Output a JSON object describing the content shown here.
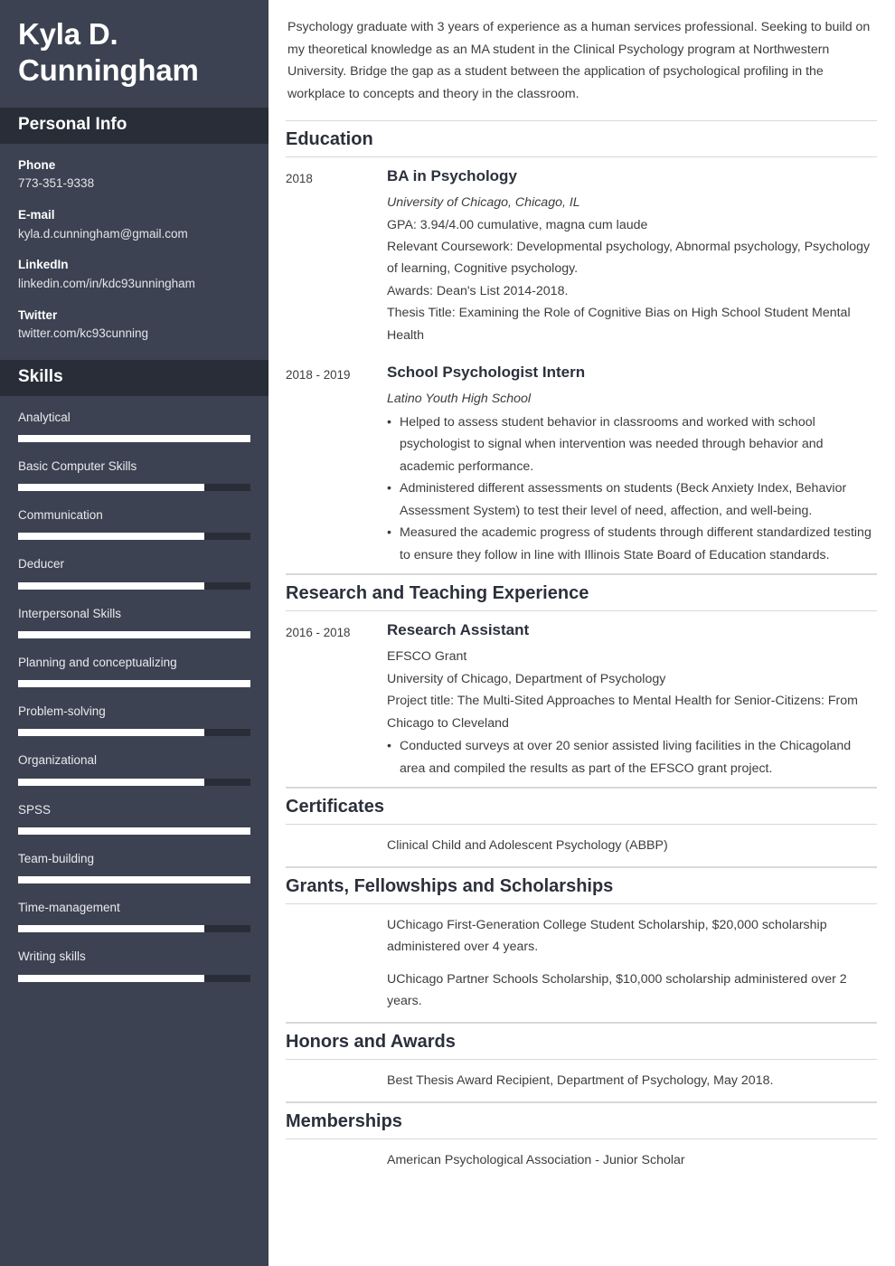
{
  "sidebar": {
    "name_lines": [
      "Kyla D.",
      "Cunningham"
    ],
    "personal_info": {
      "heading": "Personal Info",
      "items": [
        {
          "label": "Phone",
          "value": "773-351-9338"
        },
        {
          "label": "E-mail",
          "value": "kyla.d.cunningham@gmail.com"
        },
        {
          "label": "LinkedIn",
          "value": "linkedin.com/in/kdc93unningham"
        },
        {
          "label": "Twitter",
          "value": "twitter.com/kc93cunning"
        }
      ]
    },
    "skills": {
      "heading": "Skills",
      "items": [
        {
          "name": "Analytical",
          "level": 100
        },
        {
          "name": "Basic Computer Skills",
          "level": 80
        },
        {
          "name": "Communication",
          "level": 80
        },
        {
          "name": "Deducer",
          "level": 80
        },
        {
          "name": "Interpersonal Skills",
          "level": 100
        },
        {
          "name": "Planning and conceptualizing",
          "level": 100
        },
        {
          "name": "Problem-solving",
          "level": 80
        },
        {
          "name": "Organizational",
          "level": 80
        },
        {
          "name": "SPSS",
          "level": 100
        },
        {
          "name": "Team-building",
          "level": 100
        },
        {
          "name": "Time-management",
          "level": 80
        },
        {
          "name": "Writing skills",
          "level": 80
        }
      ]
    }
  },
  "main": {
    "summary": "Psychology graduate with 3 years of experience as a human services professional. Seeking to build on my theoretical knowledge as an MA student in the Clinical Psychology program at Northwestern University. Bridge the gap as a student between the application of psychological profiling in the workplace to concepts and theory in the classroom.",
    "education": {
      "heading": "Education",
      "entries": [
        {
          "date": "2018",
          "title": "BA in Psychology",
          "subtitle": "University of Chicago, Chicago, IL",
          "lines": [
            "GPA: 3.94/4.00 cumulative, magna cum laude",
            "Relevant Coursework: Developmental psychology, Abnormal psychology, Psychology of learning, Cognitive psychology.",
            "Awards: Dean's List 2014-2018.",
            "Thesis Title: Examining the Role of Cognitive Bias on High School Student Mental Health"
          ],
          "bullets": []
        },
        {
          "date": "2018 - 2019",
          "title": "School Psychologist Intern",
          "subtitle": "Latino Youth High School",
          "lines": [],
          "bullets": [
            "Helped to assess student behavior in classrooms and worked with school psychologist to signal when intervention was needed through behavior and academic performance.",
            "Administered different assessments on students (Beck Anxiety Index, Behavior Assessment System) to test their level of need, affection, and well-being.",
            "Measured the academic progress of students through different standardized testing to ensure they follow in line with Illinois State Board of Education standards."
          ]
        }
      ]
    },
    "research": {
      "heading": "Research and Teaching Experience",
      "entries": [
        {
          "date": "2016 - 2018",
          "title": "Research Assistant",
          "subtitle": "",
          "lines": [
            "EFSCO Grant",
            "University of Chicago, Department of Psychology",
            "Project title: The Multi-Sited Approaches to Mental Health for Senior-Citizens: From Chicago to Cleveland"
          ],
          "bullets": [
            "Conducted surveys at over 20 senior assisted living facilities in the Chicagoland area and compiled the results as part of the EFSCO grant project."
          ]
        }
      ]
    },
    "certificates": {
      "heading": "Certificates",
      "paragraphs": [
        "Clinical Child and Adolescent Psychology (ABBP)"
      ]
    },
    "grants": {
      "heading": "Grants, Fellowships and Scholarships",
      "paragraphs": [
        "UChicago First-Generation College Student Scholarship, $20,000 scholarship administered over 4 years.",
        "UChicago Partner Schools Scholarship, $10,000 scholarship administered over 2 years."
      ]
    },
    "honors": {
      "heading": "Honors and Awards",
      "paragraphs": [
        "Best Thesis Award Recipient, Department of Psychology, May 2018."
      ]
    },
    "memberships": {
      "heading": "Memberships",
      "paragraphs": [
        "American Psychological Association - Junior Scholar"
      ]
    }
  },
  "colors": {
    "sidebar_bg": "#3c4251",
    "band_bg": "#282d37",
    "skill_fill": "#ffffff",
    "rule": "#d8d8d8",
    "heading_text": "#2b303b",
    "body_text": "#3d3d3d"
  }
}
